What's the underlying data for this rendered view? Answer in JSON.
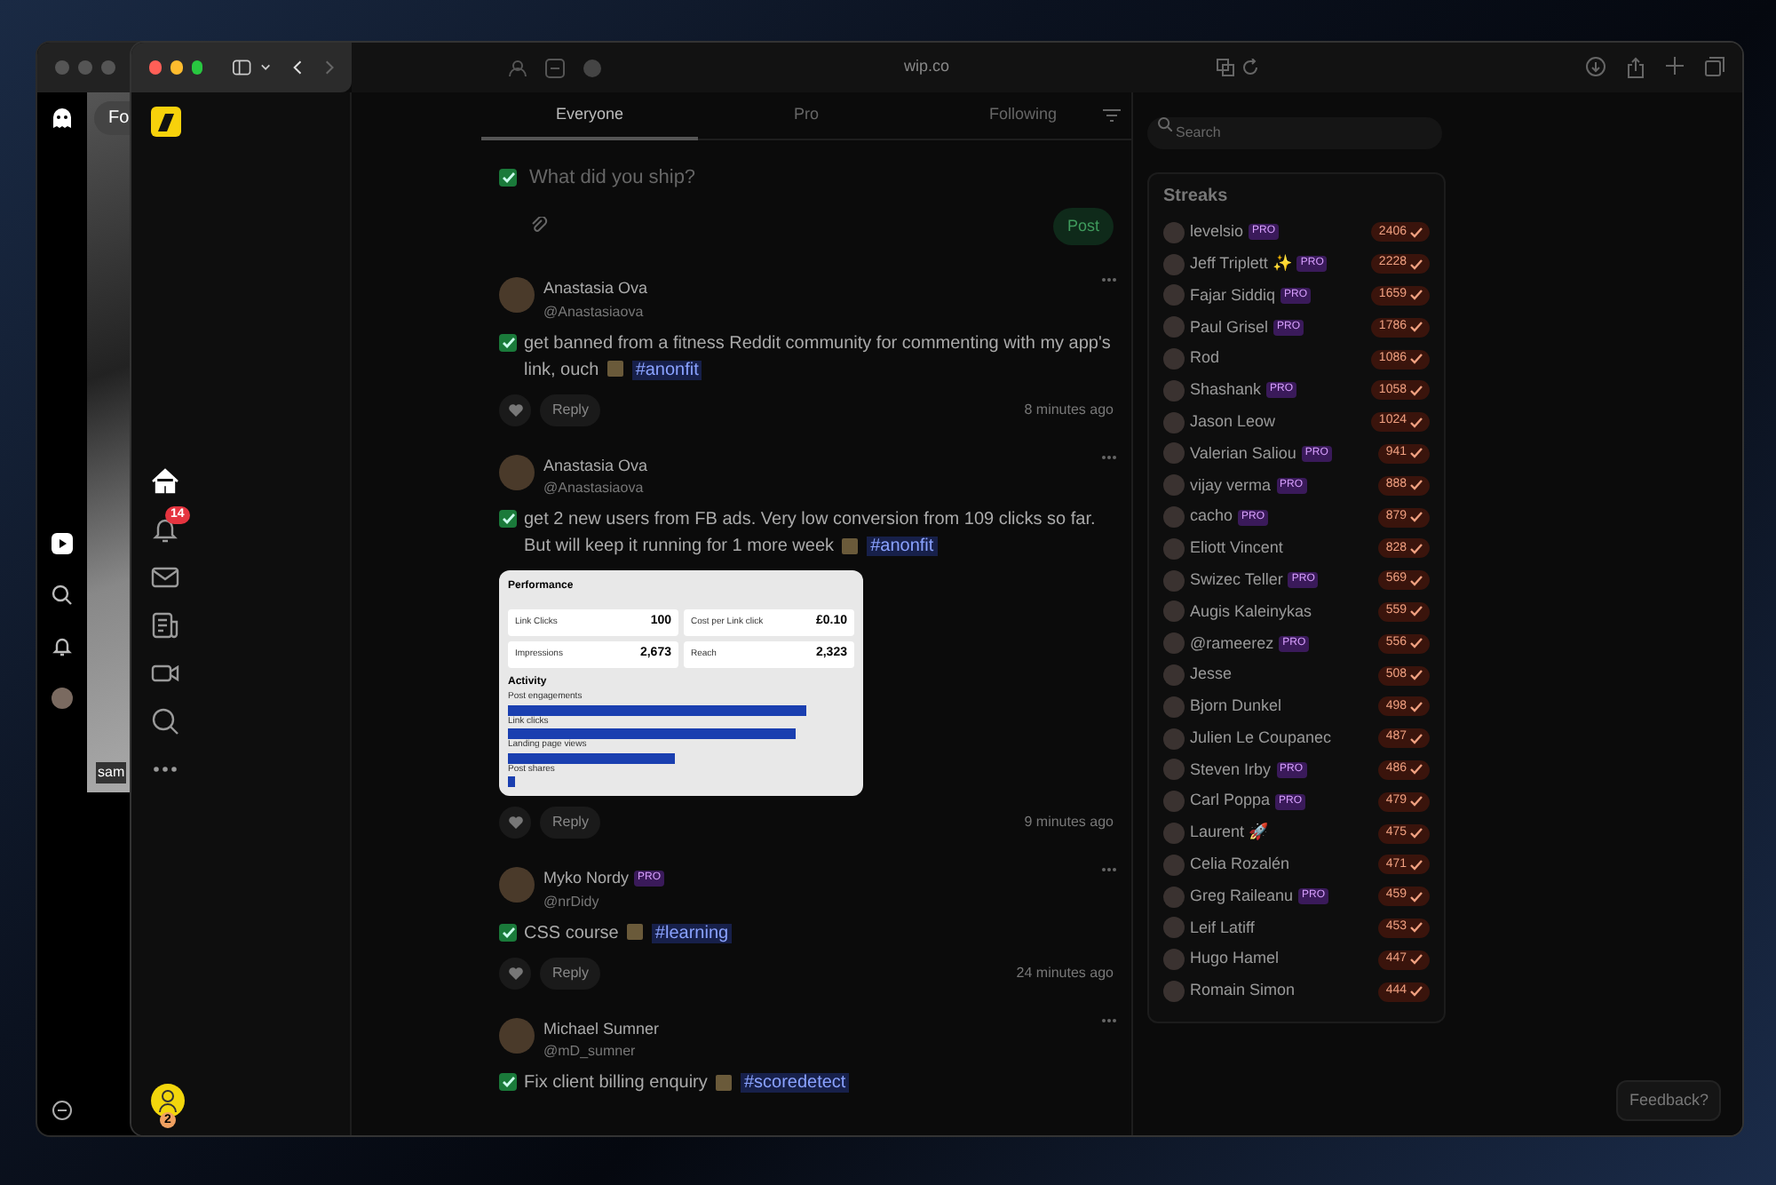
{
  "back_window": {
    "chip": "Fo",
    "caption": "sam"
  },
  "browser": {
    "url": "wip.co"
  },
  "nav": {
    "items": [
      {
        "kind": "home",
        "selected": true
      },
      {
        "kind": "bell",
        "selected": false,
        "badge": "14"
      },
      {
        "kind": "mail",
        "selected": false
      },
      {
        "kind": "news",
        "selected": false
      },
      {
        "kind": "video",
        "selected": false
      },
      {
        "kind": "search",
        "selected": false
      },
      {
        "kind": "more",
        "selected": false
      }
    ],
    "profile_badge": "2"
  },
  "tabs": [
    {
      "label": "Everyone",
      "selected": true
    },
    {
      "label": "Pro",
      "selected": false
    },
    {
      "label": "Following",
      "selected": false
    }
  ],
  "composer": {
    "checked": true,
    "placeholder": "What did you ship?",
    "button": "Post"
  },
  "posts": [
    {
      "name": "Anastasia Ova",
      "handle": "@Anastasiaova",
      "checked": true,
      "text": "get banned from a fitness Reddit community for commenting with my app's link, ouch",
      "tag": "#anonfit",
      "reply": "Reply",
      "time": "8 minutes ago"
    },
    {
      "name": "Anastasia Ova",
      "handle": "@Anastasiaova",
      "checked": true,
      "text": "get 2 new users from FB ads. Very low conversion from 109 clicks so far. But will keep it running for 1 more week",
      "tag": "#anonfit",
      "reply": "Reply",
      "time": "9 minutes ago",
      "attachment": {
        "title": "Performance",
        "stats": [
          {
            "label": "Link Clicks",
            "value": "100"
          },
          {
            "label": "Cost per Link click",
            "value": "£0.10"
          },
          {
            "label": "Impressions",
            "value": "2,673"
          },
          {
            "label": "Reach",
            "value": "2,323"
          }
        ],
        "activity_title": "Activity",
        "bars": [
          {
            "label": "Post engagements",
            "level": 0.86
          },
          {
            "label": "Link clicks",
            "level": 0.83
          },
          {
            "label": "Landing page views",
            "level": 0.48
          },
          {
            "label": "Post shares",
            "level": 0.02
          }
        ]
      }
    },
    {
      "name": "Myko Nordy",
      "pro_badge": "PRO",
      "handle": "@nrDidy",
      "checked": true,
      "text": "CSS course",
      "tag": "#learning",
      "reply": "Reply",
      "time": "24 minutes ago"
    },
    {
      "name": "Michael Sumner",
      "handle": "@mD_sumner",
      "checked": true,
      "text": "Fix client billing enquiry",
      "tag": "#scoredetect"
    }
  ],
  "search": {
    "placeholder": "Search"
  },
  "streaks": {
    "title": "Streaks",
    "rows": [
      {
        "name": "levelsio",
        "pro_badge": "PRO",
        "count": "2406"
      },
      {
        "name": "Jeff Triplett ✨",
        "pro_badge": "PRO",
        "count": "2228"
      },
      {
        "name": "Fajar Siddiq",
        "pro_badge": "PRO",
        "count": "1659"
      },
      {
        "name": "Paul Grisel",
        "pro_badge": "PRO",
        "count": "1786"
      },
      {
        "name": "Rod",
        "count": "1086"
      },
      {
        "name": "Shashank",
        "pro_badge": "PRO",
        "count": "1058"
      },
      {
        "name": "Jason Leow",
        "count": "1024"
      },
      {
        "name": "Valerian Saliou",
        "pro_badge": "PRO",
        "count": "941"
      },
      {
        "name": "vijay verma",
        "pro_badge": "PRO",
        "count": "888"
      },
      {
        "name": "cacho",
        "pro_badge": "PRO",
        "count": "879"
      },
      {
        "name": "Eliott Vincent",
        "count": "828"
      },
      {
        "name": "Swizec Teller",
        "pro_badge": "PRO",
        "count": "569"
      },
      {
        "name": "Augis Kaleinykas",
        "count": "559"
      },
      {
        "name": "@rameerez",
        "pro_badge": "PRO",
        "count": "556"
      },
      {
        "name": "Jesse",
        "count": "508"
      },
      {
        "name": "Bjorn Dunkel",
        "count": "498"
      },
      {
        "name": "Julien Le Coupanec",
        "count": "487"
      },
      {
        "name": "Steven Irby",
        "pro_badge": "PRO",
        "count": "486"
      },
      {
        "name": "Carl Poppa",
        "pro_badge": "PRO",
        "count": "479"
      },
      {
        "name": "Laurent 🚀",
        "count": "475"
      },
      {
        "name": "Celia Rozalén",
        "count": "471"
      },
      {
        "name": "Greg Raileanu",
        "pro_badge": "PRO",
        "count": "459"
      },
      {
        "name": "Leif Latiff",
        "count": "453"
      },
      {
        "name": "Hugo Hamel",
        "count": "447"
      },
      {
        "name": "Romain Simon",
        "count": "444"
      }
    ]
  },
  "feedback_button": "Feedback?"
}
